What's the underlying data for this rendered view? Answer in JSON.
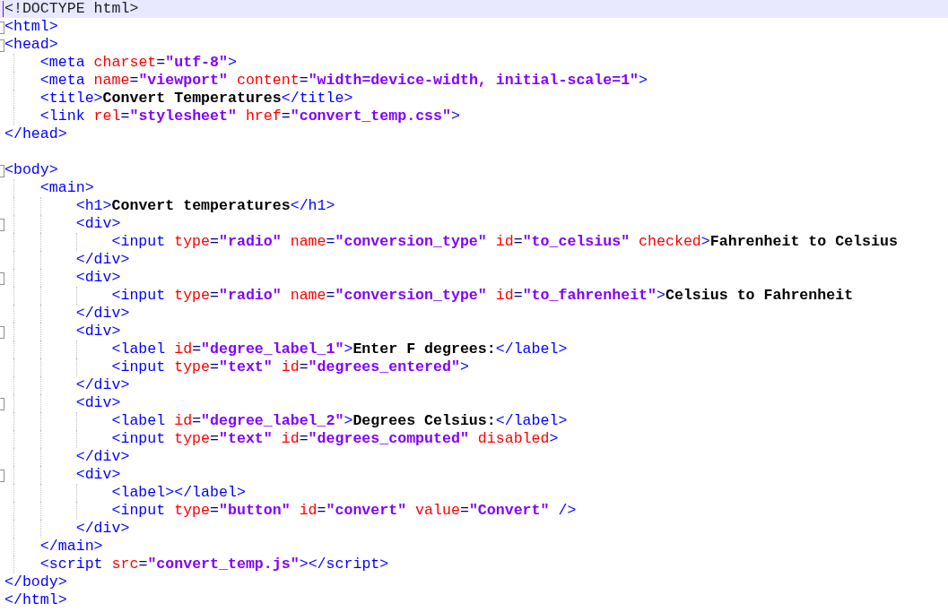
{
  "editor": {
    "lines": [
      {
        "current": true,
        "fold_marker": false,
        "tokens": [
          {
            "kind": "doctype",
            "text": "<!DOCTYPE html>"
          }
        ]
      },
      {
        "current": false,
        "fold_marker": true,
        "tokens": [
          {
            "kind": "tag",
            "text": "<html>"
          }
        ]
      },
      {
        "current": false,
        "fold_marker": true,
        "tokens": [
          {
            "kind": "tag",
            "text": "<head>"
          }
        ]
      },
      {
        "current": false,
        "fold_marker": false,
        "tokens": [
          {
            "kind": "tag",
            "text": "    <meta"
          },
          {
            "kind": "attr",
            "text": " charset"
          },
          {
            "kind": "eq",
            "text": "="
          },
          {
            "kind": "value",
            "text": "\"utf-8\""
          },
          {
            "kind": "tag",
            "text": ">"
          }
        ]
      },
      {
        "current": false,
        "fold_marker": false,
        "tokens": [
          {
            "kind": "tag",
            "text": "    <meta"
          },
          {
            "kind": "attr",
            "text": " name"
          },
          {
            "kind": "eq",
            "text": "="
          },
          {
            "kind": "value",
            "text": "\"viewport\""
          },
          {
            "kind": "attr",
            "text": " content"
          },
          {
            "kind": "eq",
            "text": "="
          },
          {
            "kind": "value",
            "text": "\"width=device-width, initial-scale=1\""
          },
          {
            "kind": "tag",
            "text": ">"
          }
        ]
      },
      {
        "current": false,
        "fold_marker": false,
        "tokens": [
          {
            "kind": "tag",
            "text": "    <title>"
          },
          {
            "kind": "text",
            "text": "Convert Temperatures"
          },
          {
            "kind": "tag",
            "text": "</title>"
          }
        ]
      },
      {
        "current": false,
        "fold_marker": false,
        "tokens": [
          {
            "kind": "tag",
            "text": "    <link"
          },
          {
            "kind": "attr",
            "text": " rel"
          },
          {
            "kind": "eq",
            "text": "="
          },
          {
            "kind": "value",
            "text": "\"stylesheet\""
          },
          {
            "kind": "attr",
            "text": " href"
          },
          {
            "kind": "eq",
            "text": "="
          },
          {
            "kind": "value",
            "text": "\"convert_temp.css\""
          },
          {
            "kind": "tag",
            "text": ">"
          }
        ]
      },
      {
        "current": false,
        "fold_marker": false,
        "tokens": [
          {
            "kind": "tag",
            "text": "</head>"
          }
        ]
      },
      {
        "current": false,
        "fold_marker": false
      },
      {
        "current": false,
        "fold_marker": true,
        "tokens": [
          {
            "kind": "tag",
            "text": "<body>"
          }
        ]
      },
      {
        "current": false,
        "fold_marker": false,
        "tokens": [
          {
            "kind": "tag",
            "text": "    <main>"
          }
        ]
      },
      {
        "current": false,
        "fold_marker": false,
        "tokens": [
          {
            "kind": "tag",
            "text": "        <h1>"
          },
          {
            "kind": "text",
            "text": "Convert temperatures"
          },
          {
            "kind": "tag",
            "text": "</h1>"
          }
        ]
      },
      {
        "current": false,
        "fold_marker": true,
        "tokens": [
          {
            "kind": "tag",
            "text": "        <div>"
          }
        ]
      },
      {
        "current": false,
        "fold_marker": false,
        "tokens": [
          {
            "kind": "tag",
            "text": "            <input"
          },
          {
            "kind": "attr",
            "text": " type"
          },
          {
            "kind": "eq",
            "text": "="
          },
          {
            "kind": "value",
            "text": "\"radio\""
          },
          {
            "kind": "attr",
            "text": " name"
          },
          {
            "kind": "eq",
            "text": "="
          },
          {
            "kind": "value",
            "text": "\"conversion_type\""
          },
          {
            "kind": "attr",
            "text": " id"
          },
          {
            "kind": "eq",
            "text": "="
          },
          {
            "kind": "value",
            "text": "\"to_celsius\""
          },
          {
            "kind": "attr",
            "text": " checked"
          },
          {
            "kind": "tag",
            "text": ">"
          },
          {
            "kind": "text",
            "text": "Fahrenheit to Celsius"
          }
        ]
      },
      {
        "current": false,
        "fold_marker": false,
        "tokens": [
          {
            "kind": "tag",
            "text": "        </div>"
          }
        ]
      },
      {
        "current": false,
        "fold_marker": true,
        "tokens": [
          {
            "kind": "tag",
            "text": "        <div>"
          }
        ]
      },
      {
        "current": false,
        "fold_marker": false,
        "tokens": [
          {
            "kind": "tag",
            "text": "            <input"
          },
          {
            "kind": "attr",
            "text": " type"
          },
          {
            "kind": "eq",
            "text": "="
          },
          {
            "kind": "value",
            "text": "\"radio\""
          },
          {
            "kind": "attr",
            "text": " name"
          },
          {
            "kind": "eq",
            "text": "="
          },
          {
            "kind": "value",
            "text": "\"conversion_type\""
          },
          {
            "kind": "attr",
            "text": " id"
          },
          {
            "kind": "eq",
            "text": "="
          },
          {
            "kind": "value",
            "text": "\"to_fahrenheit\""
          },
          {
            "kind": "tag",
            "text": ">"
          },
          {
            "kind": "text",
            "text": "Celsius to Fahrenheit"
          }
        ]
      },
      {
        "current": false,
        "fold_marker": false,
        "tokens": [
          {
            "kind": "tag",
            "text": "        </div>"
          }
        ]
      },
      {
        "current": false,
        "fold_marker": true,
        "tokens": [
          {
            "kind": "tag",
            "text": "        <div>"
          }
        ]
      },
      {
        "current": false,
        "fold_marker": false,
        "tokens": [
          {
            "kind": "tag",
            "text": "            <label"
          },
          {
            "kind": "attr",
            "text": " id"
          },
          {
            "kind": "eq",
            "text": "="
          },
          {
            "kind": "value",
            "text": "\"degree_label_1\""
          },
          {
            "kind": "tag",
            "text": ">"
          },
          {
            "kind": "text",
            "text": "Enter F degrees:"
          },
          {
            "kind": "tag",
            "text": "</label>"
          }
        ]
      },
      {
        "current": false,
        "fold_marker": false,
        "tokens": [
          {
            "kind": "tag",
            "text": "            <input"
          },
          {
            "kind": "attr",
            "text": " type"
          },
          {
            "kind": "eq",
            "text": "="
          },
          {
            "kind": "value",
            "text": "\"text\""
          },
          {
            "kind": "attr",
            "text": " id"
          },
          {
            "kind": "eq",
            "text": "="
          },
          {
            "kind": "value",
            "text": "\"degrees_entered\""
          },
          {
            "kind": "tag",
            "text": ">"
          }
        ]
      },
      {
        "current": false,
        "fold_marker": false,
        "tokens": [
          {
            "kind": "tag",
            "text": "        </div>"
          }
        ]
      },
      {
        "current": false,
        "fold_marker": true,
        "tokens": [
          {
            "kind": "tag",
            "text": "        <div>"
          }
        ]
      },
      {
        "current": false,
        "fold_marker": false,
        "tokens": [
          {
            "kind": "tag",
            "text": "            <label"
          },
          {
            "kind": "attr",
            "text": " id"
          },
          {
            "kind": "eq",
            "text": "="
          },
          {
            "kind": "value",
            "text": "\"degree_label_2\""
          },
          {
            "kind": "tag",
            "text": ">"
          },
          {
            "kind": "text",
            "text": "Degrees Celsius:"
          },
          {
            "kind": "tag",
            "text": "</label>"
          }
        ]
      },
      {
        "current": false,
        "fold_marker": false,
        "tokens": [
          {
            "kind": "tag",
            "text": "            <input"
          },
          {
            "kind": "attr",
            "text": " type"
          },
          {
            "kind": "eq",
            "text": "="
          },
          {
            "kind": "value",
            "text": "\"text\""
          },
          {
            "kind": "attr",
            "text": " id"
          },
          {
            "kind": "eq",
            "text": "="
          },
          {
            "kind": "value",
            "text": "\"degrees_computed\""
          },
          {
            "kind": "attr",
            "text": " disabled"
          },
          {
            "kind": "tag",
            "text": ">"
          }
        ]
      },
      {
        "current": false,
        "fold_marker": false,
        "tokens": [
          {
            "kind": "tag",
            "text": "        </div>"
          }
        ]
      },
      {
        "current": false,
        "fold_marker": true,
        "tokens": [
          {
            "kind": "tag",
            "text": "        <div>"
          }
        ]
      },
      {
        "current": false,
        "fold_marker": false,
        "tokens": [
          {
            "kind": "tag",
            "text": "            <label></label>"
          }
        ]
      },
      {
        "current": false,
        "fold_marker": false,
        "tokens": [
          {
            "kind": "tag",
            "text": "            <input"
          },
          {
            "kind": "attr",
            "text": " type"
          },
          {
            "kind": "eq",
            "text": "="
          },
          {
            "kind": "value",
            "text": "\"button\""
          },
          {
            "kind": "attr",
            "text": " id"
          },
          {
            "kind": "eq",
            "text": "="
          },
          {
            "kind": "value",
            "text": "\"convert\""
          },
          {
            "kind": "attr",
            "text": " value"
          },
          {
            "kind": "eq",
            "text": "="
          },
          {
            "kind": "value",
            "text": "\"Convert\""
          },
          {
            "kind": "tag",
            "text": " />"
          }
        ]
      },
      {
        "current": false,
        "fold_marker": false,
        "tokens": [
          {
            "kind": "tag",
            "text": "        </div>"
          }
        ]
      },
      {
        "current": false,
        "fold_marker": false,
        "tokens": [
          {
            "kind": "tag",
            "text": "    </main>"
          }
        ]
      },
      {
        "current": false,
        "fold_marker": false,
        "tokens": [
          {
            "kind": "tag",
            "text": "    <script"
          },
          {
            "kind": "attr",
            "text": " src"
          },
          {
            "kind": "eq",
            "text": "="
          },
          {
            "kind": "value",
            "text": "\"convert_temp.js\""
          },
          {
            "kind": "tag",
            "text": "></script>"
          }
        ]
      },
      {
        "current": false,
        "fold_marker": false,
        "tokens": [
          {
            "kind": "tag",
            "text": "</body>"
          }
        ]
      },
      {
        "current": false,
        "fold_marker": false,
        "tokens": [
          {
            "kind": "tag",
            "text": "</html>"
          }
        ]
      }
    ]
  }
}
